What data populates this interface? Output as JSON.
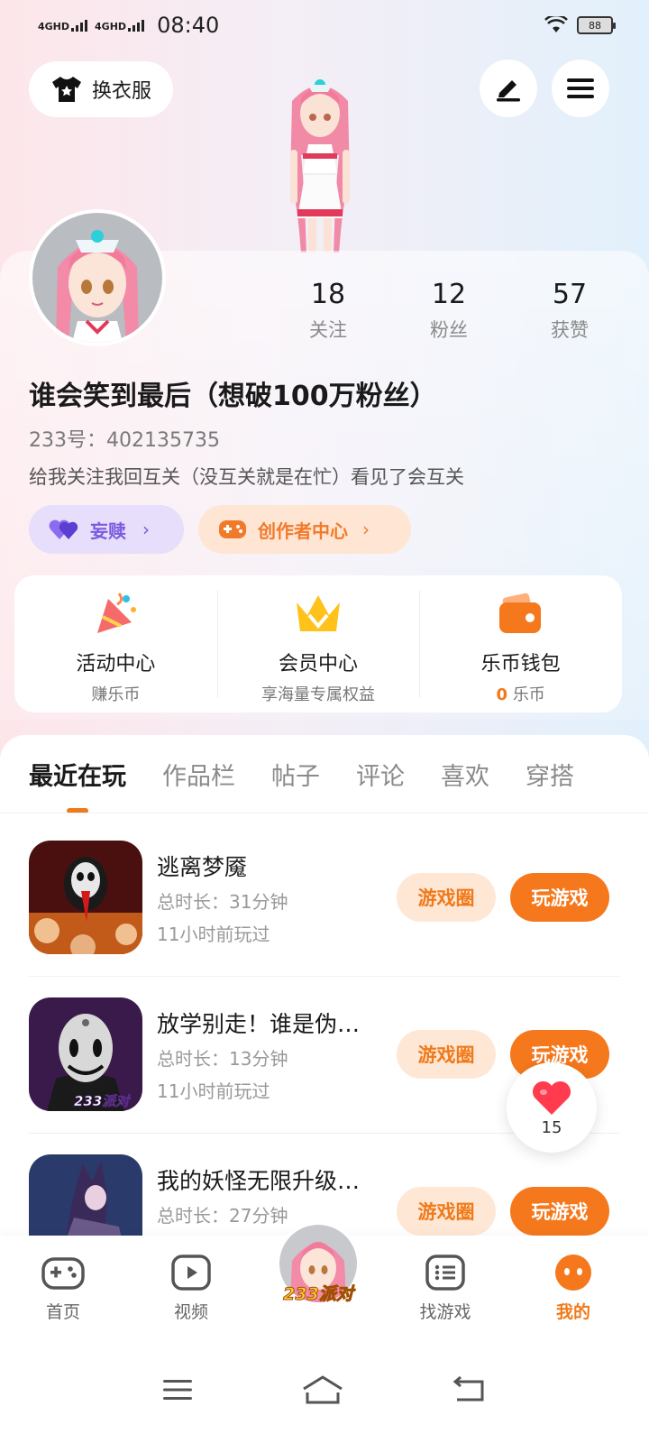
{
  "status_bar": {
    "sim1": "4GHD",
    "sim2": "4GHD",
    "time": "08:40",
    "battery": "88"
  },
  "header": {
    "outfit_label": "换衣服"
  },
  "profile": {
    "stats": [
      {
        "value": "18",
        "label": "关注"
      },
      {
        "value": "12",
        "label": "粉丝"
      },
      {
        "value": "57",
        "label": "获赞"
      }
    ],
    "username": "谁会笑到最后（想破100万粉丝）",
    "uid": "233号：402135735",
    "bio": "给我关注我回互关（没互关就是在忙）看见了会互关",
    "love_pill": "妄赎",
    "creator_pill": "创作者中心"
  },
  "services": [
    {
      "title": "活动中心",
      "sub": "赚乐币"
    },
    {
      "title": "会员中心",
      "sub": "享海量专属权益"
    },
    {
      "title": "乐币钱包",
      "sub_value": "0",
      "sub_unit": "乐币"
    }
  ],
  "tabs": [
    "最近在玩",
    "作品栏",
    "帖子",
    "评论",
    "喜欢",
    "穿搭"
  ],
  "games": [
    {
      "name": "逃离梦魇",
      "duration": "总时长：31分钟",
      "last_played": "11小时前玩过",
      "circle_label": "游戏圈",
      "play_label": "玩游戏"
    },
    {
      "name": "放学别走！谁是伪…",
      "duration": "总时长：13分钟",
      "last_played": "11小时前玩过",
      "circle_label": "游戏圈",
      "play_label": "玩游戏",
      "icon_badge": "233派对"
    },
    {
      "name": "我的妖怪无限升级…",
      "duration": "总时长：27分钟",
      "last_played": "",
      "circle_label": "游戏圈",
      "play_label": "玩游戏"
    }
  ],
  "like_float": {
    "count": "15"
  },
  "bottom_nav": {
    "home": "首页",
    "video": "视频",
    "center_brand": "233派对",
    "find": "找游戏",
    "mine": "我的"
  },
  "colors": {
    "accent": "#f5781c",
    "accent_light": "#ffe7d6",
    "love": "#7b5ae0",
    "love_bg": "#e6defa"
  }
}
